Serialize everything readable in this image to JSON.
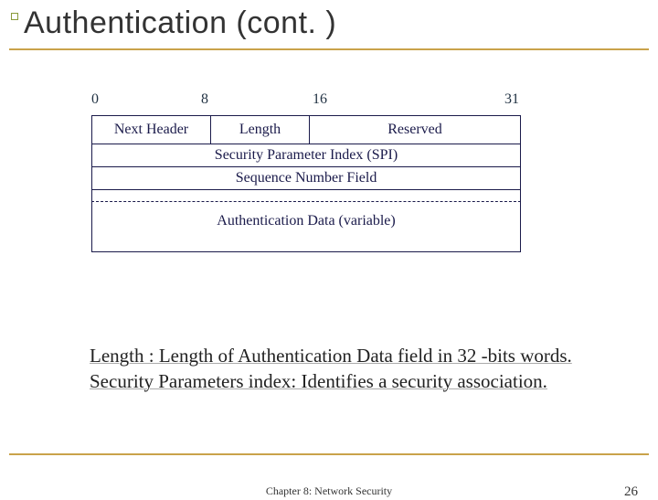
{
  "title": "Authentication (cont. )",
  "bits": {
    "b0": "0",
    "b8": "8",
    "b16": "16",
    "b31": "31"
  },
  "fields": {
    "next_header": "Next Header",
    "length": "Length",
    "reserved": "Reserved",
    "spi": "Security Parameter Index (SPI)",
    "seq": "Sequence Number Field",
    "auth": "Authentication Data (variable)"
  },
  "body": {
    "line1": "Length : Length of Authentication Data field in 32 -bits words.",
    "line2": "Security Parameters index: Identifies a security association."
  },
  "footer": {
    "center": "Chapter 8: Network Security",
    "page": "26"
  }
}
